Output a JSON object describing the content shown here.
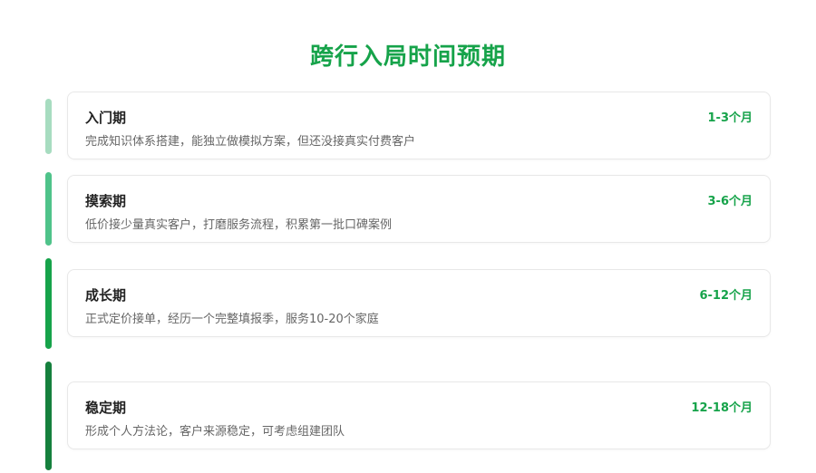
{
  "title": "跨行入局时间预期",
  "stages": [
    {
      "name": "入门期",
      "duration": "1-3个月",
      "description": "完成知识体系搭建，能独立做模拟方案，但还没接真实付费客户",
      "color": "#a7dcc0"
    },
    {
      "name": "摸索期",
      "duration": "3-6个月",
      "description": "低价接少量真实客户，打磨服务流程，积累第一批口碑案例",
      "color": "#4fc38a"
    },
    {
      "name": "成长期",
      "duration": "6-12个月",
      "description": "正式定价接单，经历一个完整填报季，服务10-20个家庭",
      "color": "#16a34a"
    },
    {
      "name": "稳定期",
      "duration": "12-18个月",
      "description": "形成个人方法论，客户来源稳定，可考虑组建团队",
      "color": "#15803d"
    }
  ]
}
